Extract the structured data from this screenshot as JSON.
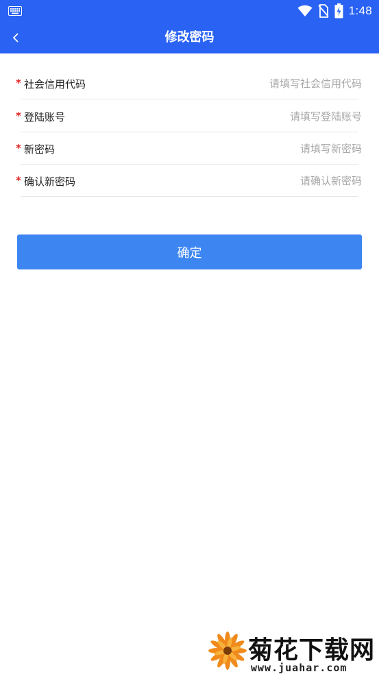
{
  "status_bar": {
    "time": "1:48",
    "icons": [
      "keyboard-icon",
      "wifi-icon",
      "no-sim-icon",
      "battery-charging-icon"
    ]
  },
  "app_bar": {
    "back_icon": "chevron-left-icon",
    "title": "修改密码"
  },
  "form": {
    "fields": [
      {
        "label": "社会信用代码",
        "placeholder": "请填写社会信用代码",
        "value": "",
        "required": true
      },
      {
        "label": "登陆账号",
        "placeholder": "请填写登陆账号",
        "value": "",
        "required": true
      },
      {
        "label": "新密码",
        "placeholder": "请填写新密码",
        "value": "",
        "required": true
      },
      {
        "label": "确认新密码",
        "placeholder": "请确认新密码",
        "value": "",
        "required": true
      }
    ],
    "required_mark": "*"
  },
  "submit": {
    "label": "确定"
  },
  "watermark": {
    "brand": "菊花下载网",
    "url": "www.juahar.com"
  },
  "colors": {
    "primary": "#2a63f3",
    "button": "#3d86f2",
    "required": "#e02020",
    "placeholder": "#a8a8a8"
  }
}
